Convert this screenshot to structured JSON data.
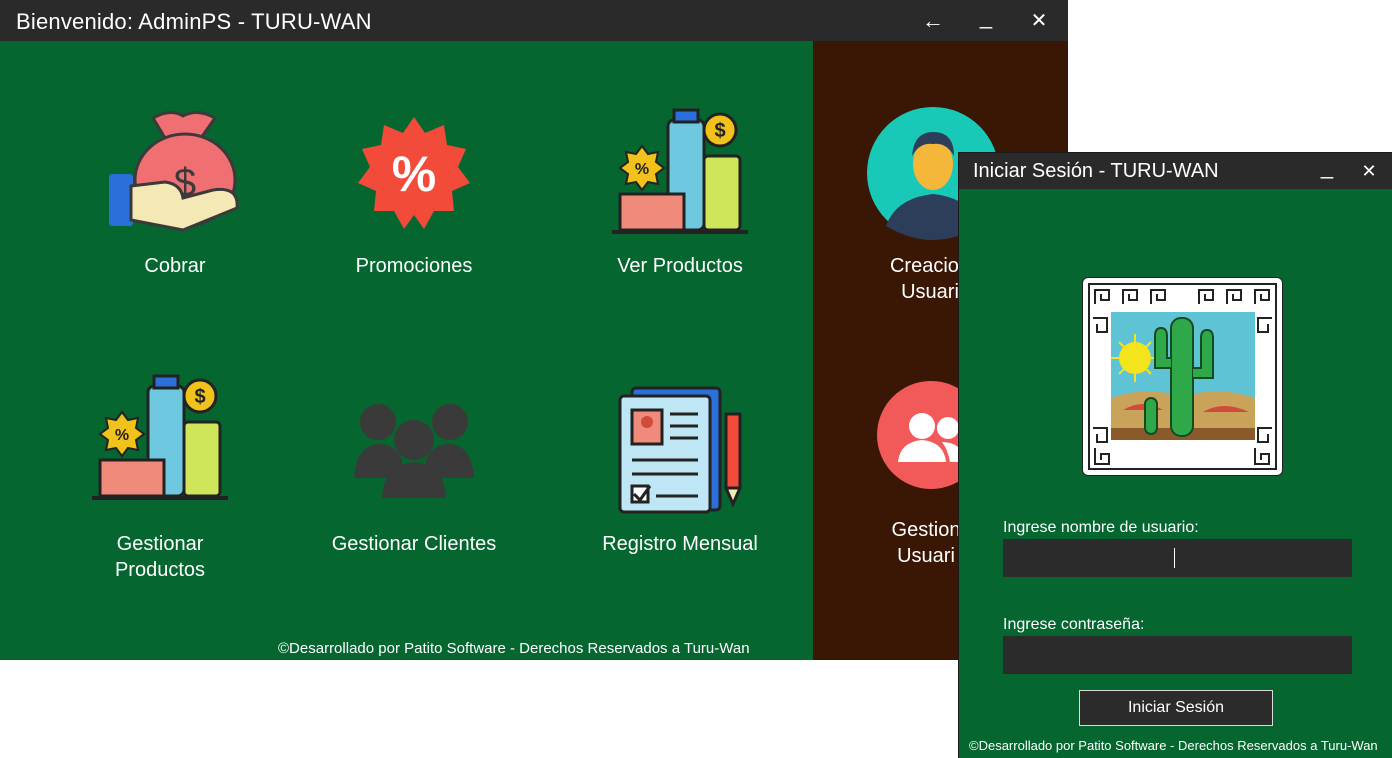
{
  "main_window": {
    "title": "Bienvenido: AdminPS - TURU-WAN",
    "controls": {
      "back": "←",
      "minimize": "_",
      "close": "✕"
    },
    "tiles": {
      "cobrar": "Cobrar",
      "promociones": "Promociones",
      "ver_productos": "Ver Productos",
      "creacion_usuarios_line1": "Creacion",
      "creacion_usuarios_line2": "Usuari",
      "gestionar_productos_line1": "Gestionar",
      "gestionar_productos_line2": "Productos",
      "gestionar_clientes": "Gestionar Clientes",
      "registro_mensual": "Registro Mensual",
      "gestion_usuarios_line1": "Gestion",
      "gestion_usuarios_line2": "Usuari"
    },
    "footer": "©Desarrollado por Patito Software - Derechos Reservados a Turu-Wan"
  },
  "login_window": {
    "title": "Iniciar Sesión - TURU-WAN",
    "controls": {
      "minimize": "_",
      "close": "✕"
    },
    "username_label": "Ingrese nombre de usuario:",
    "username_value": "",
    "password_label": "Ingrese contraseña:",
    "password_value": "",
    "login_button": "Iniciar Sesión",
    "footer": "©Desarrollado por Patito Software - Derechos Reservados a Turu-Wan"
  },
  "colors": {
    "main_bg": "#056630",
    "titlebar": "#2a2a2a",
    "admin_panel": "#3a1705",
    "input_bg": "#2b2b2b"
  }
}
